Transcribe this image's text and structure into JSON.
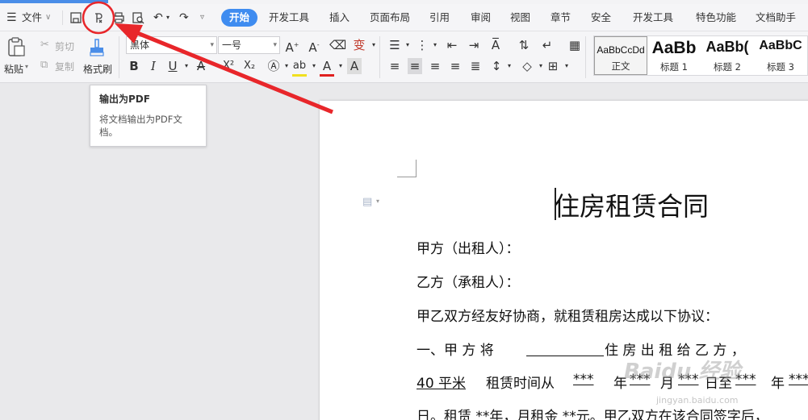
{
  "menubar": {
    "file_label": "文件",
    "tabs": [
      {
        "label": "开始",
        "active": true
      },
      {
        "label": "开发工具"
      },
      {
        "label": "插入"
      },
      {
        "label": "页面布局"
      },
      {
        "label": "引用"
      },
      {
        "label": "审阅"
      },
      {
        "label": "视图"
      },
      {
        "label": "章节"
      },
      {
        "label": "安全"
      },
      {
        "label": "开发工具"
      },
      {
        "label": "特色功能"
      },
      {
        "label": "文档助手"
      }
    ]
  },
  "ribbon": {
    "paste": "粘贴",
    "cut": "剪切",
    "copy": "复制",
    "format_painter": "格式刷",
    "font_name": "黑体",
    "font_size": "一号"
  },
  "styles": [
    {
      "sample": "AaBbCcDd",
      "label": "正文"
    },
    {
      "sample": "AaBb",
      "label": "标题 1"
    },
    {
      "sample": "AaBb(",
      "label": "标题 2"
    },
    {
      "sample": "AaBbC",
      "label": "标题 3"
    }
  ],
  "tooltip": {
    "title": "输出为PDF",
    "desc": "将文档输出为PDF文档。"
  },
  "document": {
    "title": "住房租赁合同",
    "party_a": "甲方（出租人）：",
    "party_b": "乙方（承租人）：",
    "agreement": "甲乙双方经友好协商，就租赁租房达成以下协议：",
    "clause1_a": "一、甲  方  将",
    "clause1_b": "住  房  出  租  给  乙  方  ，",
    "area": "40 平米",
    "term": "租赁时间从",
    "stars": "***",
    "year": "年",
    "month": "月",
    "day_to": "日至",
    "rent_line": "日。租赁  **年，月租金  **元。甲乙双方在该合同签字后，"
  },
  "watermark": {
    "text": "Baidu 经验",
    "url": "jingyan.baidu.com"
  },
  "colors": {
    "accent": "#3f8cf0",
    "annotation": "#e8262a"
  }
}
